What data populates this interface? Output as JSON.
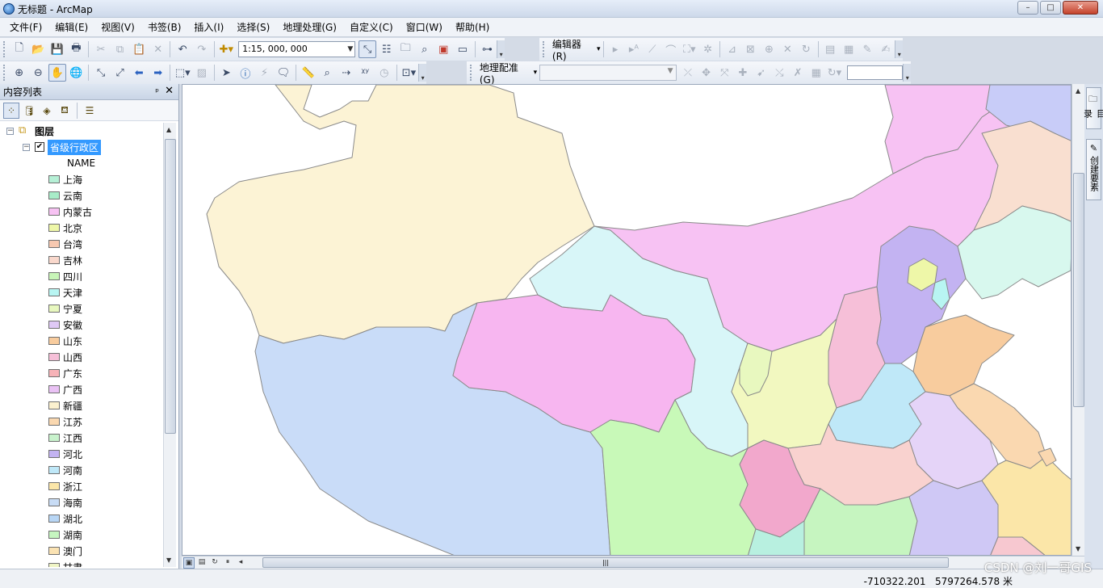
{
  "window": {
    "title": "无标题 - ArcMap",
    "buttons": [
      "–",
      "□",
      "✕"
    ]
  },
  "menu": [
    "文件(F)",
    "编辑(E)",
    "视图(V)",
    "书签(B)",
    "插入(I)",
    "选择(S)",
    "地理处理(G)",
    "自定义(C)",
    "窗口(W)",
    "帮助(H)"
  ],
  "toolbar": {
    "scale_value": "1:15, 000, 000",
    "editor_label": "编辑器(R)",
    "georef_label": "地理配准(G)"
  },
  "toc": {
    "title": "内容列表",
    "root_label": "图层",
    "layer_label": "省级行政区",
    "field_label": "NAME",
    "legend": [
      {
        "name": "上海",
        "color": "#b6f0d6"
      },
      {
        "name": "云南",
        "color": "#a8ecc8"
      },
      {
        "name": "内蒙古",
        "color": "#f7c2f3"
      },
      {
        "name": "北京",
        "color": "#eef7a8"
      },
      {
        "name": "台湾",
        "color": "#f7c8b0"
      },
      {
        "name": "吉林",
        "color": "#f9d8cc"
      },
      {
        "name": "四川",
        "color": "#c8f5b8"
      },
      {
        "name": "天津",
        "color": "#b8f5f2"
      },
      {
        "name": "宁夏",
        "color": "#e8f8bf"
      },
      {
        "name": "安徽",
        "color": "#dfc9f5"
      },
      {
        "name": "山东",
        "color": "#f8cc9e"
      },
      {
        "name": "山西",
        "color": "#f6bfd8"
      },
      {
        "name": "广东",
        "color": "#f7b3b8"
      },
      {
        "name": "广西",
        "color": "#eac2f5"
      },
      {
        "name": "新疆",
        "color": "#fcf1cf"
      },
      {
        "name": "江苏",
        "color": "#fad8b0"
      },
      {
        "name": "江西",
        "color": "#c8f2cc"
      },
      {
        "name": "河北",
        "color": "#c3b3f2"
      },
      {
        "name": "河南",
        "color": "#bfe8f8"
      },
      {
        "name": "浙江",
        "color": "#fbe6a8"
      },
      {
        "name": "海南",
        "color": "#c8dcf5"
      },
      {
        "name": "湖北",
        "color": "#b8d6f5"
      },
      {
        "name": "湖南",
        "color": "#c6f5c0"
      },
      {
        "name": "澳门",
        "color": "#fbe3b3"
      },
      {
        "name": "甘肃",
        "color": "#f0f5c5"
      }
    ]
  },
  "dock": {
    "catalog": "目录",
    "create_features": "创建要素"
  },
  "status": {
    "x": "-710322.201",
    "y": "5797264.578",
    "unit": "米"
  },
  "watermark": "CSDN @刘一哥GIS",
  "map_colors": {
    "xinjiang": "#fcf3d5",
    "tibet": "#c9dcf8",
    "qinghai": "#f7b6f0",
    "gansu": "#d8f6f8",
    "innermongolia": "#f7c2f3",
    "sichuan": "#c8f9b8",
    "shaanxi": "#f2f8c0",
    "ningxia": "#e8f8bf",
    "shanxi": "#f6bfd8",
    "hebei": "#c3b3f2",
    "beijing": "#eef7a8",
    "shandong": "#f8cc9e",
    "henan": "#bfe8f8",
    "hubei": "#f9d2cf",
    "anhui": "#e5d4f8",
    "jiangsu": "#fad8b0",
    "chongqing": "#f2a8cc",
    "hunan": "#c6f5c0",
    "jiangxi": "#cfc8f5",
    "zhejiang": "#fbe6a8",
    "liaoning": "#d8f8ee",
    "jilin": "#f9dfd0",
    "heilongjiang": "#f7c2f3",
    "heilongjiang_ne": "#c8ccf8",
    "guizhou": "#b8f0e0",
    "fujian": "#f7c8d0",
    "tianjin": "#b8f5f2"
  }
}
